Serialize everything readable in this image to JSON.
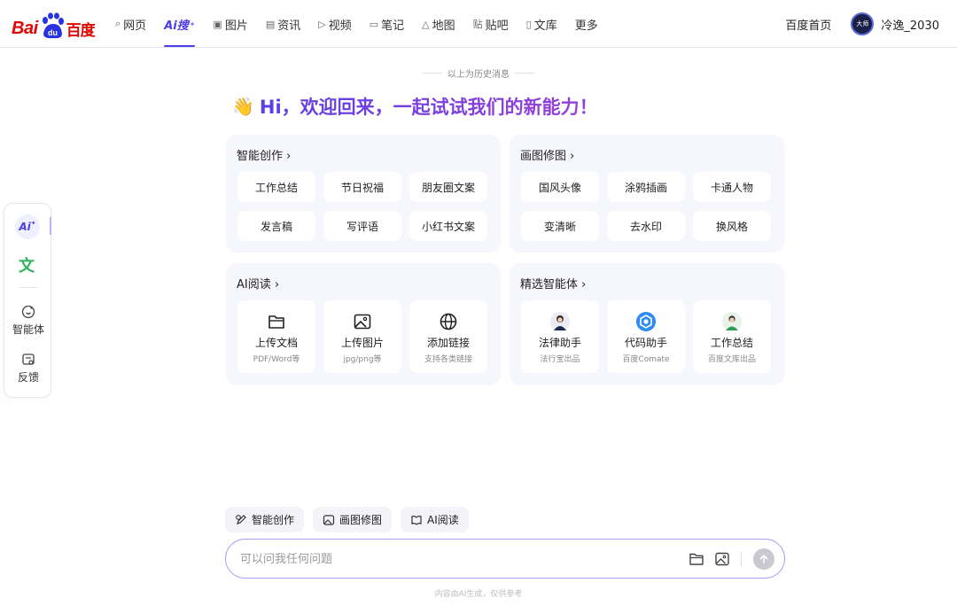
{
  "logo": {
    "bai": "Bai",
    "du": "du",
    "cn": "百度"
  },
  "nav": [
    {
      "icon": "search-icon",
      "glyph": "⌕",
      "label": "网页"
    },
    {
      "icon": "ai-icon",
      "label": "Ai搜",
      "active": true
    },
    {
      "icon": "image-icon",
      "glyph": "▣",
      "label": "图片"
    },
    {
      "icon": "news-icon",
      "glyph": "▤",
      "label": "资讯"
    },
    {
      "icon": "video-icon",
      "glyph": "▷",
      "label": "视频"
    },
    {
      "icon": "note-icon",
      "glyph": "▭",
      "label": "笔记"
    },
    {
      "icon": "map-icon",
      "glyph": "△",
      "label": "地图"
    },
    {
      "icon": "tieba-icon",
      "glyph": "贴",
      "label": "贴吧"
    },
    {
      "icon": "wenku-icon",
      "glyph": "▯",
      "label": "文库"
    },
    {
      "label": "更多"
    }
  ],
  "header_right": {
    "home": "百度首页",
    "username": "冷逸_2030",
    "avatar_text": "大师"
  },
  "history_label": "以上为历史消息",
  "greeting": {
    "emoji": "👋",
    "text": "Hi，欢迎回来，一起试试我们的新能力！"
  },
  "cards": {
    "creation": {
      "title": "智能创作 ›",
      "items": [
        "工作总结",
        "节日祝福",
        "朋友圈文案",
        "发言稿",
        "写评语",
        "小红书文案"
      ]
    },
    "image_edit": {
      "title": "画图修图 ›",
      "items": [
        "国风头像",
        "涂鸦插画",
        "卡通人物",
        "变清晰",
        "去水印",
        "换风格"
      ]
    },
    "ai_read": {
      "title": "AI阅读 ›",
      "tiles": [
        {
          "icon": "folder-icon",
          "name": "上传文档",
          "sub": "PDF/Word等"
        },
        {
          "icon": "image-icon",
          "name": "上传图片",
          "sub": "jpg/png等"
        },
        {
          "icon": "globe-icon",
          "name": "添加链接",
          "sub": "支持各类链接"
        }
      ]
    },
    "agents": {
      "title": "精选智能体 ›",
      "tiles": [
        {
          "icon": "lawyer-avatar-icon",
          "name": "法律助手",
          "sub": "法行宝出品"
        },
        {
          "icon": "code-assistant-icon",
          "name": "代码助手",
          "sub": "百度Comate"
        },
        {
          "icon": "worker-avatar-icon",
          "name": "工作总结",
          "sub": "百度文库出品"
        }
      ]
    }
  },
  "sidebar": {
    "ai_label": "Ai",
    "wen_label": "文",
    "agent_label": "智能体",
    "feedback_label": "反馈"
  },
  "chips": [
    "智能创作",
    "画图修图",
    "AI阅读"
  ],
  "input": {
    "placeholder": "可以问我任何问题"
  },
  "footer": "内容由AI生成，仅供参考",
  "colors": {
    "brand_red": "#e10602",
    "accent": "#4e3ee8",
    "card_bg": "#f6f6fd",
    "input_border": "#a99ff2"
  }
}
